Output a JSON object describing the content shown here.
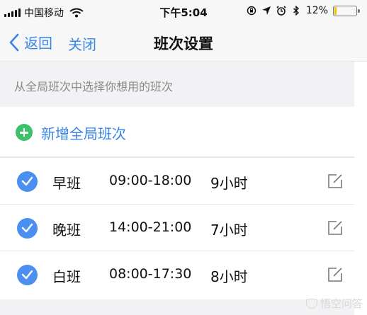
{
  "status_bar": {
    "carrier": "中国移动",
    "time": "下午5:04",
    "battery_percent": "12%",
    "battery_level": 0.12,
    "battery_color": "#f2c400",
    "icons": [
      "signal-icon",
      "wifi-icon",
      "orientation-lock-icon",
      "location-icon",
      "alarm-icon",
      "bluetooth-icon",
      "battery-icon"
    ]
  },
  "nav": {
    "back_label": "返回",
    "close_label": "关闭",
    "title": "班次设置"
  },
  "hint": "从全局班次中选择你想用的班次",
  "add_button": {
    "label": "新增全局班次",
    "icon": "plus-circle-icon",
    "color": "#3dc16a"
  },
  "accent_color": "#3a86e8",
  "shifts": [
    {
      "name": "早班",
      "time": "09:00-18:00",
      "hours": "9小时",
      "checked": true
    },
    {
      "name": "晚班",
      "time": "14:00-21:00",
      "hours": "7小时",
      "checked": true
    },
    {
      "name": "白班",
      "time": "08:00-17:30",
      "hours": "8小时",
      "checked": true
    }
  ],
  "watermark": "悟空问答"
}
